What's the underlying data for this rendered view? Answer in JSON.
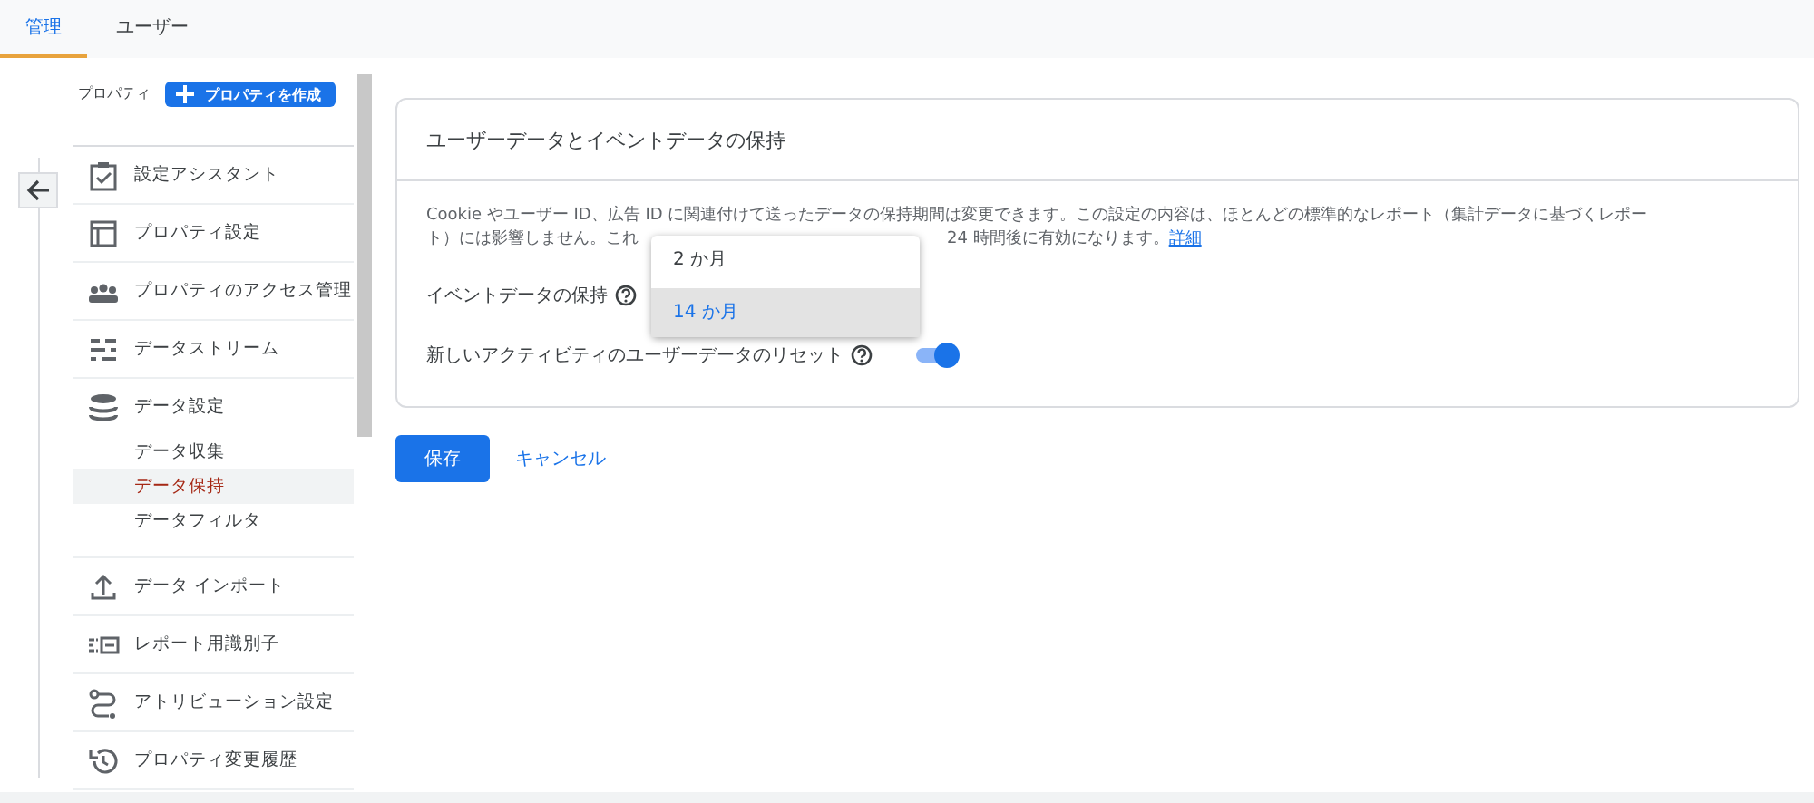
{
  "tabs": [
    {
      "label": "管理",
      "selected": true
    },
    {
      "label": "ユーザー",
      "selected": false
    }
  ],
  "sidebar": {
    "property_label": "プロパティ",
    "create_button": "プロパティを作成",
    "items": [
      {
        "kind": "item",
        "label": "設定アシスタント"
      },
      {
        "kind": "item",
        "label": "プロパティ設定"
      },
      {
        "kind": "item",
        "label": "プロパティのアクセス管理"
      },
      {
        "kind": "item",
        "label": "データストリーム"
      },
      {
        "kind": "item",
        "label": "データ設定",
        "children": [
          {
            "label": "データ収集",
            "selected": false
          },
          {
            "label": "データ保持",
            "selected": true
          },
          {
            "label": "データフィルタ",
            "selected": false
          }
        ]
      },
      {
        "kind": "item",
        "label": "データ インポート"
      },
      {
        "kind": "item",
        "label": "レポート用識別子"
      },
      {
        "kind": "item",
        "label": "アトリビューション設定"
      },
      {
        "kind": "item",
        "label": "プロパティ変更履歴"
      }
    ]
  },
  "card": {
    "title": "ユーザーデータとイベントデータの保持",
    "description_line_1": "Cookie やユーザー ID、広告 ID に関連付けて送ったデータの保持期間は変更できます。この設定の内容は、ほとんどの標準的なレポート（集計データに基づくレポー",
    "description_line_2_start": "ト）には影響しません。これ",
    "description_line_2_end": "24 時間後に有効になります。",
    "details_link": "詳細",
    "event_retention_label": "イベントデータの保持",
    "dropdown_options": [
      {
        "label": "2 か月",
        "selected": false
      },
      {
        "label": "14 か月",
        "selected": true
      }
    ],
    "reset_label": "新しいアクティビティのユーザーデータのリセット",
    "reset_toggle": {
      "on": true
    }
  },
  "buttons": {
    "save": "保存",
    "cancel": "キャンセル"
  }
}
